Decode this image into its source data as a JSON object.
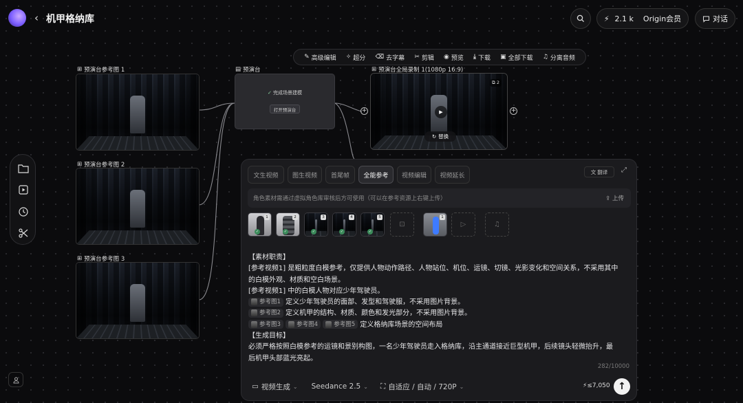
{
  "header": {
    "back_icon": "chevron-left-icon",
    "title": "机甲格纳库",
    "points": "2.1 k",
    "membership": "Origin会员",
    "chat": "对话"
  },
  "toolbar": {
    "items": [
      "高级编辑",
      "超分",
      "去字幕",
      "剪辑",
      "预览",
      "下载",
      "全部下载",
      "分离音频"
    ]
  },
  "canvas": {
    "refs": [
      "预演台参考图 1",
      "预演台参考图 2",
      "预演台参考图 3"
    ],
    "stage": {
      "label": "预演台",
      "done": "完成场景建模",
      "open": "打开预演台"
    },
    "video": {
      "label": "预演台全局录制 1(1080p 16:9)",
      "badge": "2",
      "replace": "替换"
    }
  },
  "panel": {
    "tabs": [
      "文生视频",
      "图生视频",
      "首尾帧",
      "全能参考",
      "视频编辑",
      "视频延长"
    ],
    "active_tab": "全能参考",
    "translate": "翻译",
    "notice": "角色素材需通过虚拟角色库审核后方可使用（可以在参考资源上右键上传）",
    "upload": "上传",
    "ref_nums": [
      "1",
      "2",
      "3",
      "4",
      "5",
      "1"
    ],
    "prompt": {
      "l1": "【素材职责】",
      "l2": "[参考视频1] 是粗粒度白模参考，仅提供人物动作路径、人物站位、机位、运镜、切镜、光影变化和空间关系，不采用其中",
      "l3": "的白模外观、材质和空白场景。",
      "l4": "[参考视频1] 中的白模人物对应少年驾驶员。",
      "chip1": "参考图1",
      "l5": "定义少年驾驶员的面部、发型和驾驶服，不采用图片背景。",
      "chip2": "参考图2",
      "l6": "定义机甲的结构、材质、颜色和发光部分，不采用图片背景。",
      "chip3": "参考图3",
      "chip4": "参考图4",
      "chip5": "参考图5",
      "l7": "定义格纳库场景的空间布局",
      "l8": "【生成目标】",
      "l9": "必须严格按照白模参考的运镜和景别构图，一名少年驾驶员走入格纳库，沿主通道接近巨型机甲，后续镜头轻微抬升，最",
      "l10": "后机甲头部蓝光亮起。"
    },
    "counter": "282/10000",
    "mode": "视频生成",
    "model": "Seedance 2.5",
    "settings": "自适应 / 自动 / 720P",
    "credits": "≤7,050"
  }
}
